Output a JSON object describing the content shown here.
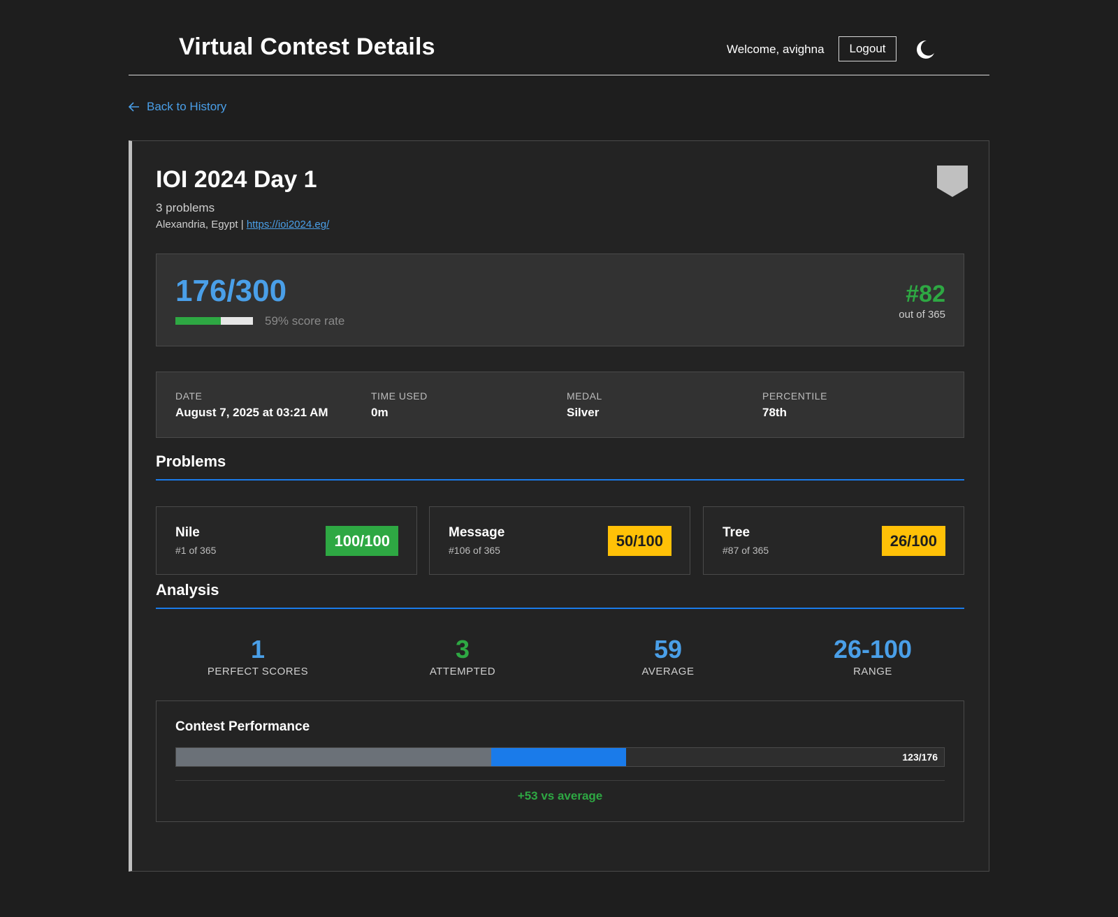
{
  "header": {
    "title": "Virtual Contest Details",
    "welcome": "Welcome, avighna",
    "logout_label": "Logout",
    "theme_icon": "moon-icon"
  },
  "back_link": {
    "label": "Back to History",
    "icon": "arrow-left-icon"
  },
  "contest": {
    "name": "IOI 2024 Day 1",
    "problems_count": "3 problems",
    "location": "Alexandria, Egypt",
    "separator": " | ",
    "url": "https://ioi2024.eg/",
    "medal_icon": "medal-shield-icon"
  },
  "score": {
    "value": "176/300",
    "rate_label": "59% score rate",
    "rate_fraction": 0.59,
    "rank": "#82",
    "rank_sub": "out of 365"
  },
  "info": [
    {
      "label": "DATE",
      "value": "August 7, 2025 at 03:21 AM"
    },
    {
      "label": "TIME USED",
      "value": "0m"
    },
    {
      "label": "MEDAL",
      "value": "Silver"
    },
    {
      "label": "PERCENTILE",
      "value": "78th"
    }
  ],
  "sections": {
    "problems": "Problems",
    "analysis": "Analysis"
  },
  "problems": [
    {
      "name": "Nile",
      "rank": "#1 of 365",
      "score": "100/100",
      "status": "full"
    },
    {
      "name": "Message",
      "rank": "#106 of 365",
      "score": "50/100",
      "status": "partial"
    },
    {
      "name": "Tree",
      "rank": "#87 of 365",
      "score": "26/100",
      "status": "partial"
    }
  ],
  "analysis": [
    {
      "value": "1",
      "label": "PERFECT SCORES",
      "color": "#4a9fe8"
    },
    {
      "value": "3",
      "label": "ATTEMPTED",
      "color": "#2ea843"
    },
    {
      "value": "59",
      "label": "AVERAGE",
      "color": "#4a9fe8"
    },
    {
      "value": "26-100",
      "label": "RANGE",
      "color": "#4a9fe8"
    }
  ],
  "performance": {
    "title": "Contest Performance",
    "average_fraction": 0.41,
    "score_fraction": 0.586,
    "bar_label": "123/176",
    "diff_label": "+53 vs average"
  },
  "colors": {
    "accent": "#4a9fe8",
    "success": "#2ea843",
    "warning": "#ffc107",
    "section_line": "#1a7bea",
    "avg_segment": "#6b7178",
    "score_segment": "#1a7bea"
  }
}
